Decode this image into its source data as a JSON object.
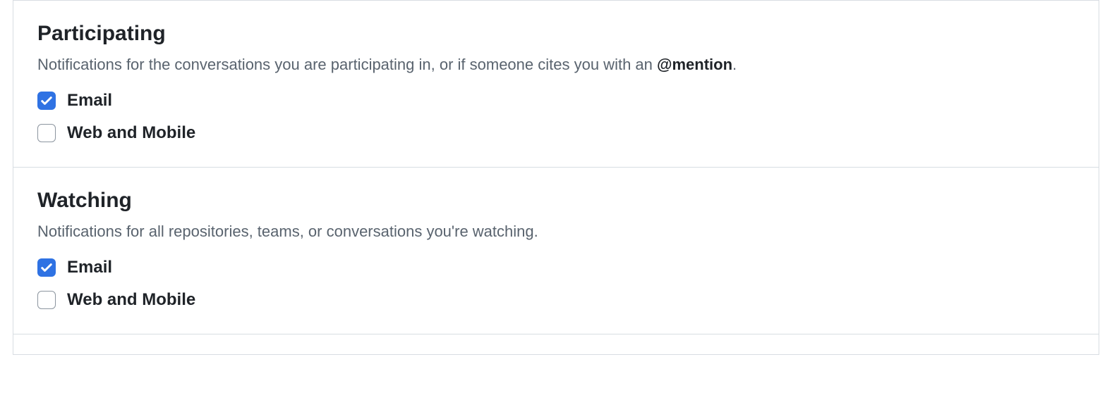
{
  "participating": {
    "title": "Participating",
    "desc_before": "Notifications for the conversations you are participating in, or if someone cites you with an ",
    "desc_bold": "@mention",
    "desc_after": ".",
    "options": {
      "email": {
        "label": "Email",
        "checked": true
      },
      "web_mobile": {
        "label": "Web and Mobile",
        "checked": false
      }
    }
  },
  "watching": {
    "title": "Watching",
    "desc": "Notifications for all repositories, teams, or conversations you're watching.",
    "options": {
      "email": {
        "label": "Email",
        "checked": true
      },
      "web_mobile": {
        "label": "Web and Mobile",
        "checked": false
      }
    }
  }
}
